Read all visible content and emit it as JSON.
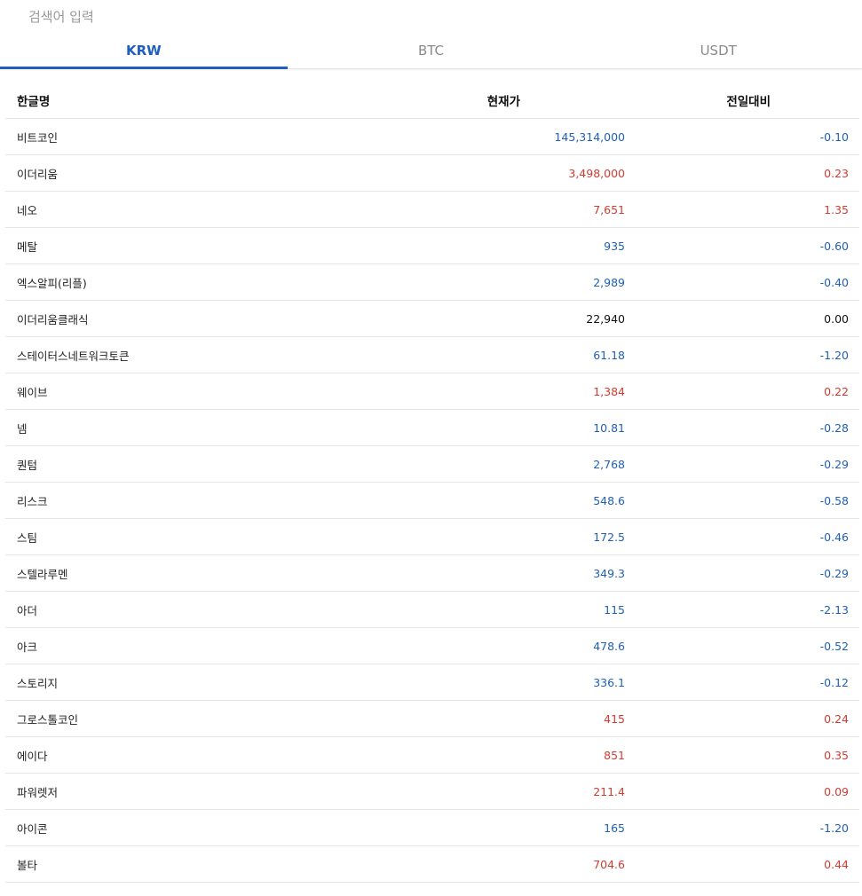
{
  "search": {
    "placeholder": "검색어 입력"
  },
  "tabs": [
    {
      "label": "KRW",
      "active": true
    },
    {
      "label": "BTC",
      "active": false
    },
    {
      "label": "USDT",
      "active": false
    }
  ],
  "table": {
    "headers": {
      "name": "한글명",
      "price": "현재가",
      "change": "전일대비"
    },
    "rows": [
      {
        "name": "비트코인",
        "price": "145,314,000",
        "change": "-0.10",
        "dir": "down"
      },
      {
        "name": "이더리움",
        "price": "3,498,000",
        "change": "0.23",
        "dir": "up"
      },
      {
        "name": "네오",
        "price": "7,651",
        "change": "1.35",
        "dir": "up"
      },
      {
        "name": "메탈",
        "price": "935",
        "change": "-0.60",
        "dir": "down"
      },
      {
        "name": "엑스알피(리플)",
        "price": "2,989",
        "change": "-0.40",
        "dir": "down"
      },
      {
        "name": "이더리움클래식",
        "price": "22,940",
        "change": "0.00",
        "dir": "flat"
      },
      {
        "name": "스테이터스네트워크토큰",
        "price": "61.18",
        "change": "-1.20",
        "dir": "down"
      },
      {
        "name": "웨이브",
        "price": "1,384",
        "change": "0.22",
        "dir": "up"
      },
      {
        "name": "넴",
        "price": "10.81",
        "change": "-0.28",
        "dir": "down"
      },
      {
        "name": "퀀텀",
        "price": "2,768",
        "change": "-0.29",
        "dir": "down"
      },
      {
        "name": "리스크",
        "price": "548.6",
        "change": "-0.58",
        "dir": "down"
      },
      {
        "name": "스팀",
        "price": "172.5",
        "change": "-0.46",
        "dir": "down"
      },
      {
        "name": "스텔라루멘",
        "price": "349.3",
        "change": "-0.29",
        "dir": "down"
      },
      {
        "name": "아더",
        "price": "115",
        "change": "-2.13",
        "dir": "down"
      },
      {
        "name": "아크",
        "price": "478.6",
        "change": "-0.52",
        "dir": "down"
      },
      {
        "name": "스토리지",
        "price": "336.1",
        "change": "-0.12",
        "dir": "down"
      },
      {
        "name": "그로스톨코인",
        "price": "415",
        "change": "0.24",
        "dir": "up"
      },
      {
        "name": "에이다",
        "price": "851",
        "change": "0.35",
        "dir": "up"
      },
      {
        "name": "파워렛저",
        "price": "211.4",
        "change": "0.09",
        "dir": "up"
      },
      {
        "name": "아이콘",
        "price": "165",
        "change": "-1.20",
        "dir": "down"
      },
      {
        "name": "볼타",
        "price": "704.6",
        "change": "0.44",
        "dir": "up"
      }
    ]
  },
  "colors": {
    "accent": "#1e5fbf",
    "up": "#d23b32",
    "down": "#1f5fb8"
  }
}
